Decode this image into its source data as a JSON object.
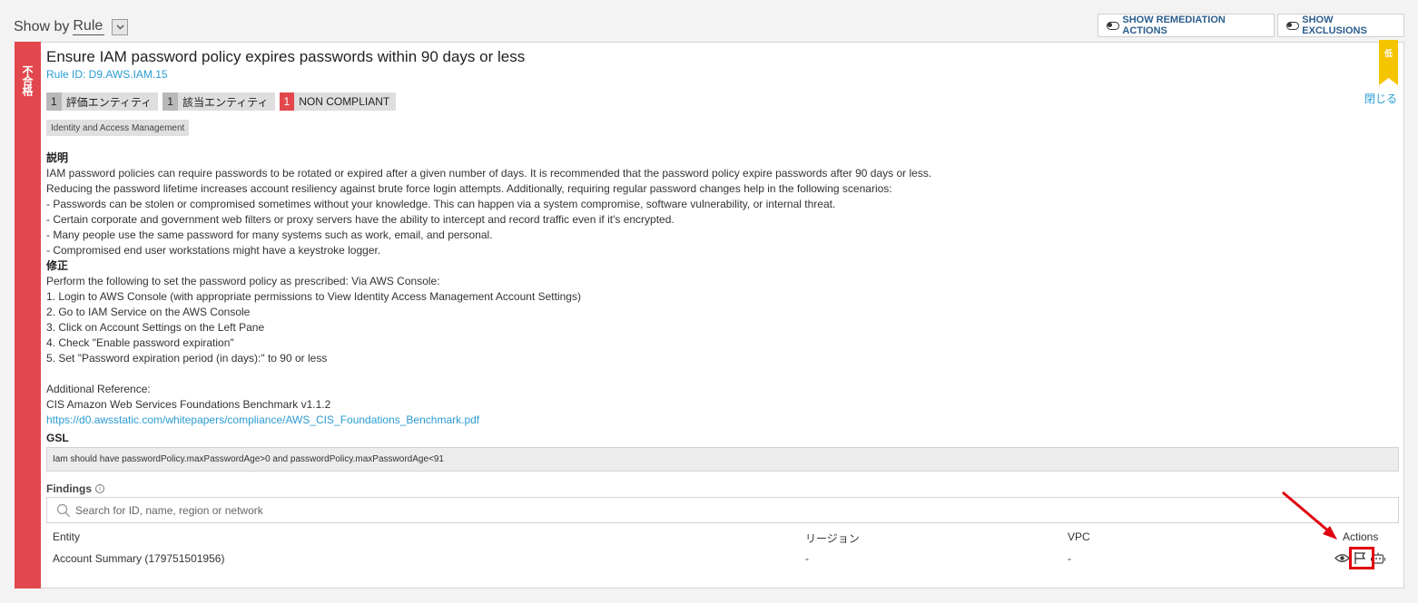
{
  "toolbar": {
    "show_by_label": "Show by",
    "show_by_value": "Rule",
    "show_remediation_label": "SHOW REMEDIATION ACTIONS",
    "show_exclusions_label": "SHOW EXCLUSIONS"
  },
  "rule": {
    "status_label": "不合格",
    "title": "Ensure IAM password policy expires passwords within 90 days or less",
    "rule_id": "Rule ID: D9.AWS.IAM.15",
    "severity_label": "低",
    "close_label": "閉じる",
    "badges": [
      {
        "count": "1",
        "label": "評価エンティティ"
      },
      {
        "count": "1",
        "label": "該当エンティティ"
      },
      {
        "count": "1",
        "label": "NON COMPLIANT"
      }
    ],
    "tag": "Identity and Access Management"
  },
  "description": {
    "heading": "説明",
    "lines": [
      "IAM password policies can require passwords to be rotated or expired after a given number of days. It is recommended that the password policy expire passwords after 90 days or less.",
      "Reducing the password lifetime increases account resiliency against brute force login attempts. Additionally, requiring regular password changes help in the following scenarios:",
      "- Passwords can be stolen or compromised sometimes without your knowledge. This can happen via a system compromise, software vulnerability, or internal threat.",
      "- Certain corporate and government web filters or proxy servers have the ability to intercept and record traffic even if it's encrypted.",
      "- Many people use the same password for many systems such as work, email, and personal.",
      "- Compromised end user workstations might have a keystroke logger."
    ]
  },
  "remediation": {
    "heading": "修正",
    "lines": [
      "Perform the following to set the password policy as prescribed: Via AWS Console:",
      "1. Login to AWS Console (with appropriate permissions to View Identity Access Management Account Settings)",
      "2. Go to IAM Service on the AWS Console",
      "3. Click on Account Settings on the Left Pane",
      "4. Check \"Enable password expiration\"",
      "5. Set \"Password expiration period (in days):\" to 90 or less"
    ],
    "reference_label": "Additional Reference:",
    "reference_title": "CIS Amazon Web Services Foundations Benchmark v1.1.2",
    "reference_link": "https://d0.awsstatic.com/whitepapers/compliance/AWS_CIS_Foundations_Benchmark.pdf"
  },
  "gsl": {
    "heading": "GSL",
    "expression": "Iam should have passwordPolicy.maxPasswordAge>0 and passwordPolicy.maxPasswordAge<91"
  },
  "findings": {
    "heading": "Findings",
    "search_placeholder": "Search for ID, name, region or network",
    "columns": {
      "entity": "Entity",
      "region": "リージョン",
      "vpc": "VPC",
      "actions": "Actions"
    },
    "rows": [
      {
        "entity": "Account Summary (179751501956)",
        "region": "-",
        "vpc": "-"
      }
    ]
  },
  "colors": {
    "fail_red": "#e1474d",
    "link_blue": "#2a9bd3",
    "severity_yellow": "#f5c400",
    "highlight_red": "#e0000f"
  },
  "icons": [
    "toggle-icon",
    "dropdown-chevron-icon",
    "search-icon",
    "info-icon",
    "eye-icon",
    "flag-icon",
    "robot-icon",
    "severity-ribbon-icon",
    "annotation-arrow-icon"
  ]
}
